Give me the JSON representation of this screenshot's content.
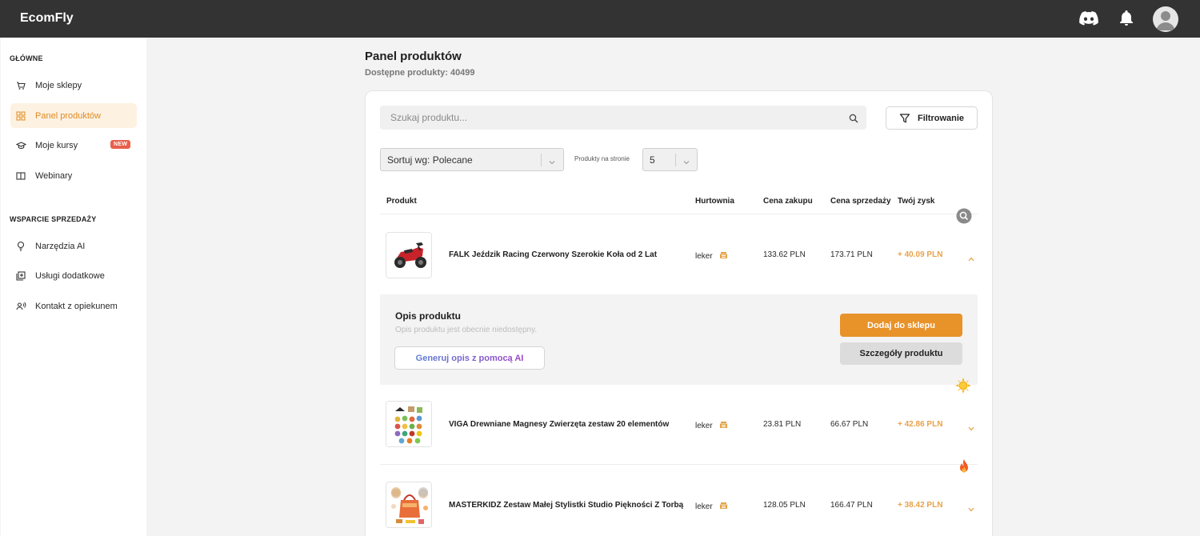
{
  "app": {
    "brand": "EcomFly"
  },
  "topbar": {
    "icons": [
      "discord-icon",
      "bell-icon",
      "avatar-icon"
    ]
  },
  "sidebar": {
    "sections": [
      {
        "title": "GŁÓWNE"
      },
      {
        "title": "WSPARCIE SPRZEDAŻY"
      }
    ],
    "items": [
      {
        "label": "Moje sklepy",
        "icon": "cart-icon"
      },
      {
        "label": "Panel produktów",
        "icon": "grid-icon",
        "active": true
      },
      {
        "label": "Moje kursy",
        "icon": "graduation-cap-icon",
        "badge": "NEW"
      },
      {
        "label": "Webinary",
        "icon": "book-icon"
      },
      {
        "label": "Narzędzia AI",
        "icon": "lightbulb-icon"
      },
      {
        "label": "Usługi dodatkowe",
        "icon": "add-box-icon"
      },
      {
        "label": "Kontakt z opiekunem",
        "icon": "contact-icon"
      }
    ]
  },
  "page": {
    "title": "Panel produktów",
    "subtitle": "Dostępne produkty: 40499"
  },
  "search": {
    "placeholder": "Szukaj produktu..."
  },
  "filter": {
    "label": "Filtrowanie"
  },
  "sort": {
    "label": "Sortuj wg: Polecane"
  },
  "per_page": {
    "label": "Produkty na stronie",
    "value": "5"
  },
  "table": {
    "headers": {
      "product": "Produkt",
      "wholesaler": "Hurtownia",
      "buy_price": "Cena zakupu",
      "sell_price": "Cena sprzedaży",
      "profit": "Twój zysk"
    },
    "rows": [
      {
        "name": "FALK Jeździk Racing Czerwony Szerokie Koła od 2 Lat",
        "wholesaler": "leker",
        "buy": "133.62 PLN",
        "sell": "173.71 PLN",
        "profit": "+ 40.09 PLN",
        "expanded": true,
        "marker": "search-badge-icon"
      },
      {
        "name": "VIGA Drewniane Magnesy Zwierzęta zestaw 20 elementów",
        "wholesaler": "leker",
        "buy": "23.81 PLN",
        "sell": "66.67 PLN",
        "profit": "+ 42.86 PLN",
        "expanded": false,
        "marker": "sun-icon"
      },
      {
        "name": "MASTERKIDZ Zestaw Małej Stylistki Studio Piękności Z Torbą",
        "wholesaler": "leker",
        "buy": "128.05 PLN",
        "sell": "166.47 PLN",
        "profit": "+ 38.42 PLN",
        "expanded": false,
        "marker": "fire-icon"
      }
    ]
  },
  "expanded": {
    "title": "Opis produktu",
    "description": "Opis produktu jest obecnie niedostępny.",
    "ai_button": "Generuj opis z pomocą AI",
    "add_button": "Dodaj do sklepu",
    "details_button": "Szczegóły produktu"
  },
  "colors": {
    "accent": "#e8922a",
    "profit": "#e8a24a",
    "topbar": "#333333",
    "badge": "#e8604c"
  }
}
